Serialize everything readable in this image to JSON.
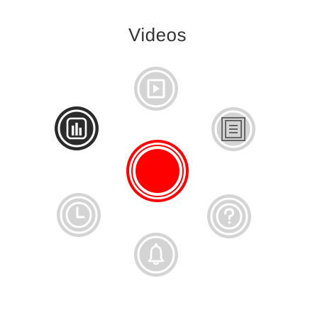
{
  "title": "Videos",
  "menu": {
    "items": [
      {
        "icon": "video-icon",
        "active": false
      },
      {
        "icon": "document-icon",
        "active": false
      },
      {
        "icon": "help-icon",
        "active": false
      },
      {
        "icon": "bell-icon",
        "active": false
      },
      {
        "icon": "clock-icon",
        "active": false
      },
      {
        "icon": "bar-chart-icon",
        "active": true
      }
    ],
    "center": {
      "icon": "record-icon"
    }
  },
  "colors": {
    "item_bg": "#d4d4d4",
    "item_icon": "#ffffff",
    "active_bg": "#2b2b2b",
    "accent": "#ff0000",
    "title": "#333333"
  }
}
